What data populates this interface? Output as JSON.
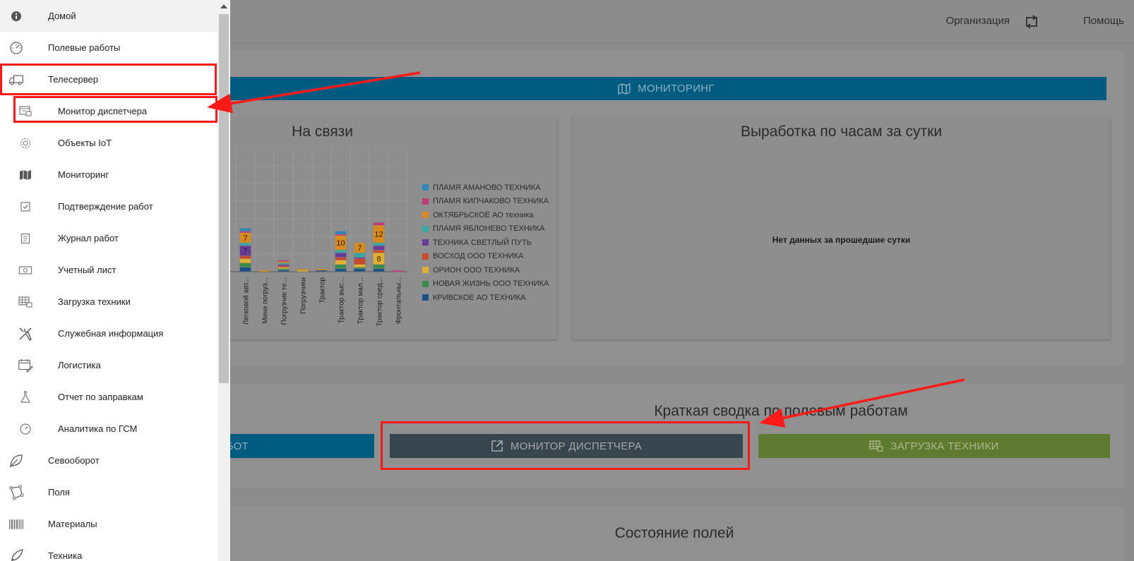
{
  "topbar": {
    "organization": "Организация",
    "help": "Помощь"
  },
  "monitoring_bar": {
    "label": "МОНИТОРИНГ"
  },
  "chart_online": {
    "title": "На связи"
  },
  "chart_data": {
    "type": "bar",
    "stacked": true,
    "categories": [
      "Легковой авт...",
      "Мини погруз...",
      "Погрузчик те...",
      "Погрузчики",
      "Трактор",
      "Трактор выс...",
      "Трактор мал...",
      "Трактор сред...",
      "Фронтальны..."
    ],
    "series": [
      {
        "name": "ПЛАМЯ АМАНОВО ТЕХНИКА",
        "color": "#2b88b8",
        "values": [
          2,
          0,
          0,
          0,
          0,
          2,
          0,
          0,
          0
        ]
      },
      {
        "name": "ПЛАМЯ КИПЧАКОВО ТЕХНИКА",
        "color": "#c23a79",
        "values": [
          1,
          0,
          1,
          0,
          0,
          1,
          0,
          2,
          1
        ]
      },
      {
        "name": "ОКТЯБРЬСКОЕ АО техника",
        "color": "#d98a1f",
        "values": [
          7,
          1,
          1,
          1,
          1,
          10,
          7,
          12,
          0
        ]
      },
      {
        "name": "ПЛАМЯ ЯБЛОНЕВО ТЕХНИКА",
        "color": "#3aa8a0",
        "values": [
          2,
          0,
          1,
          0,
          0,
          2,
          3,
          2,
          0
        ]
      },
      {
        "name": "ТЕХНИКА СВЕТЛЫЙ ПУТЬ",
        "color": "#6a3a98",
        "values": [
          7,
          0,
          1,
          0,
          0,
          3,
          1,
          3,
          0
        ]
      },
      {
        "name": "ВОСХОД ООО ТЕХНИКА",
        "color": "#c84a2a",
        "values": [
          2,
          0,
          1,
          0,
          0,
          2,
          4,
          2,
          0
        ]
      },
      {
        "name": "ОРИОН ООО ТЕХНИКА",
        "color": "#e0b030",
        "values": [
          3,
          0,
          1,
          1,
          0,
          3,
          2,
          8,
          0
        ]
      },
      {
        "name": "НОВАЯ ЖИЗНЬ ООО ТЕХНИКА",
        "color": "#3d8a4a",
        "values": [
          3,
          0,
          1,
          0,
          0,
          3,
          1,
          3,
          0
        ]
      },
      {
        "name": "КРИВСКОЕ АО ТЕХНИКА",
        "color": "#1a4f8a",
        "values": [
          3,
          0,
          1,
          0,
          1,
          2,
          2,
          2,
          0
        ]
      }
    ],
    "data_labels": [
      {
        "category": 0,
        "series": 2,
        "text": "7"
      },
      {
        "category": 0,
        "series": 4,
        "text": "7"
      },
      {
        "category": 5,
        "series": 2,
        "text": "10"
      },
      {
        "category": 6,
        "series": 2,
        "text": "7"
      },
      {
        "category": 7,
        "series": 2,
        "text": "12"
      },
      {
        "category": 7,
        "series": 6,
        "text": "8"
      }
    ],
    "legend_position": "right",
    "grid": true
  },
  "chart_hours": {
    "title": "Выработка по часам за сутки",
    "no_data": "Нет данных за прошедшие сутки"
  },
  "summary": {
    "title": "Краткая сводка по полевым работам",
    "btn_left": "БОТ",
    "btn_dispatcher": "МОНИТОР ДИСПЕТЧЕРА",
    "btn_loading": "ЗАГРУЗКА ТЕХНИКИ"
  },
  "fields_state": {
    "title": "Состояние полей"
  },
  "sidebar": {
    "items": [
      {
        "label": "Домой",
        "icon": "info-icon",
        "level": "top"
      },
      {
        "label": "Полевые работы",
        "icon": "gauge-icon",
        "level": "top"
      },
      {
        "label": "Телесервер",
        "icon": "truck-icon",
        "level": "top"
      },
      {
        "label": "Монитор диспетчера",
        "icon": "dashboard-icon",
        "level": "sub"
      },
      {
        "label": "Объекты IoT",
        "icon": "gear-icon",
        "level": "sub"
      },
      {
        "label": "Мониторинг",
        "icon": "map-icon",
        "level": "sub"
      },
      {
        "label": "Подтверждение работ",
        "icon": "checkbox-icon",
        "level": "sub"
      },
      {
        "label": "Журнал работ",
        "icon": "journal-icon",
        "level": "sub"
      },
      {
        "label": "Учетный лист",
        "icon": "money-icon",
        "level": "sub"
      },
      {
        "label": "Загрузка техники",
        "icon": "loading-icon",
        "level": "sub"
      },
      {
        "label": "Служебная информация",
        "icon": "tools-icon",
        "level": "sub"
      },
      {
        "label": "Логистика",
        "icon": "calendar-edit-icon",
        "level": "sub"
      },
      {
        "label": "Отчет по заправкам",
        "icon": "flask-icon",
        "level": "sub"
      },
      {
        "label": "Аналитика по ГСМ",
        "icon": "gauge-small-icon",
        "level": "sub"
      },
      {
        "label": "Севооборот",
        "icon": "leaf-icon",
        "level": "top"
      },
      {
        "label": "Поля",
        "icon": "polygon-icon",
        "level": "top"
      },
      {
        "label": "Материалы",
        "icon": "barcode-icon",
        "level": "top"
      },
      {
        "label": "Техника",
        "icon": "rocket-icon",
        "level": "top"
      }
    ]
  }
}
